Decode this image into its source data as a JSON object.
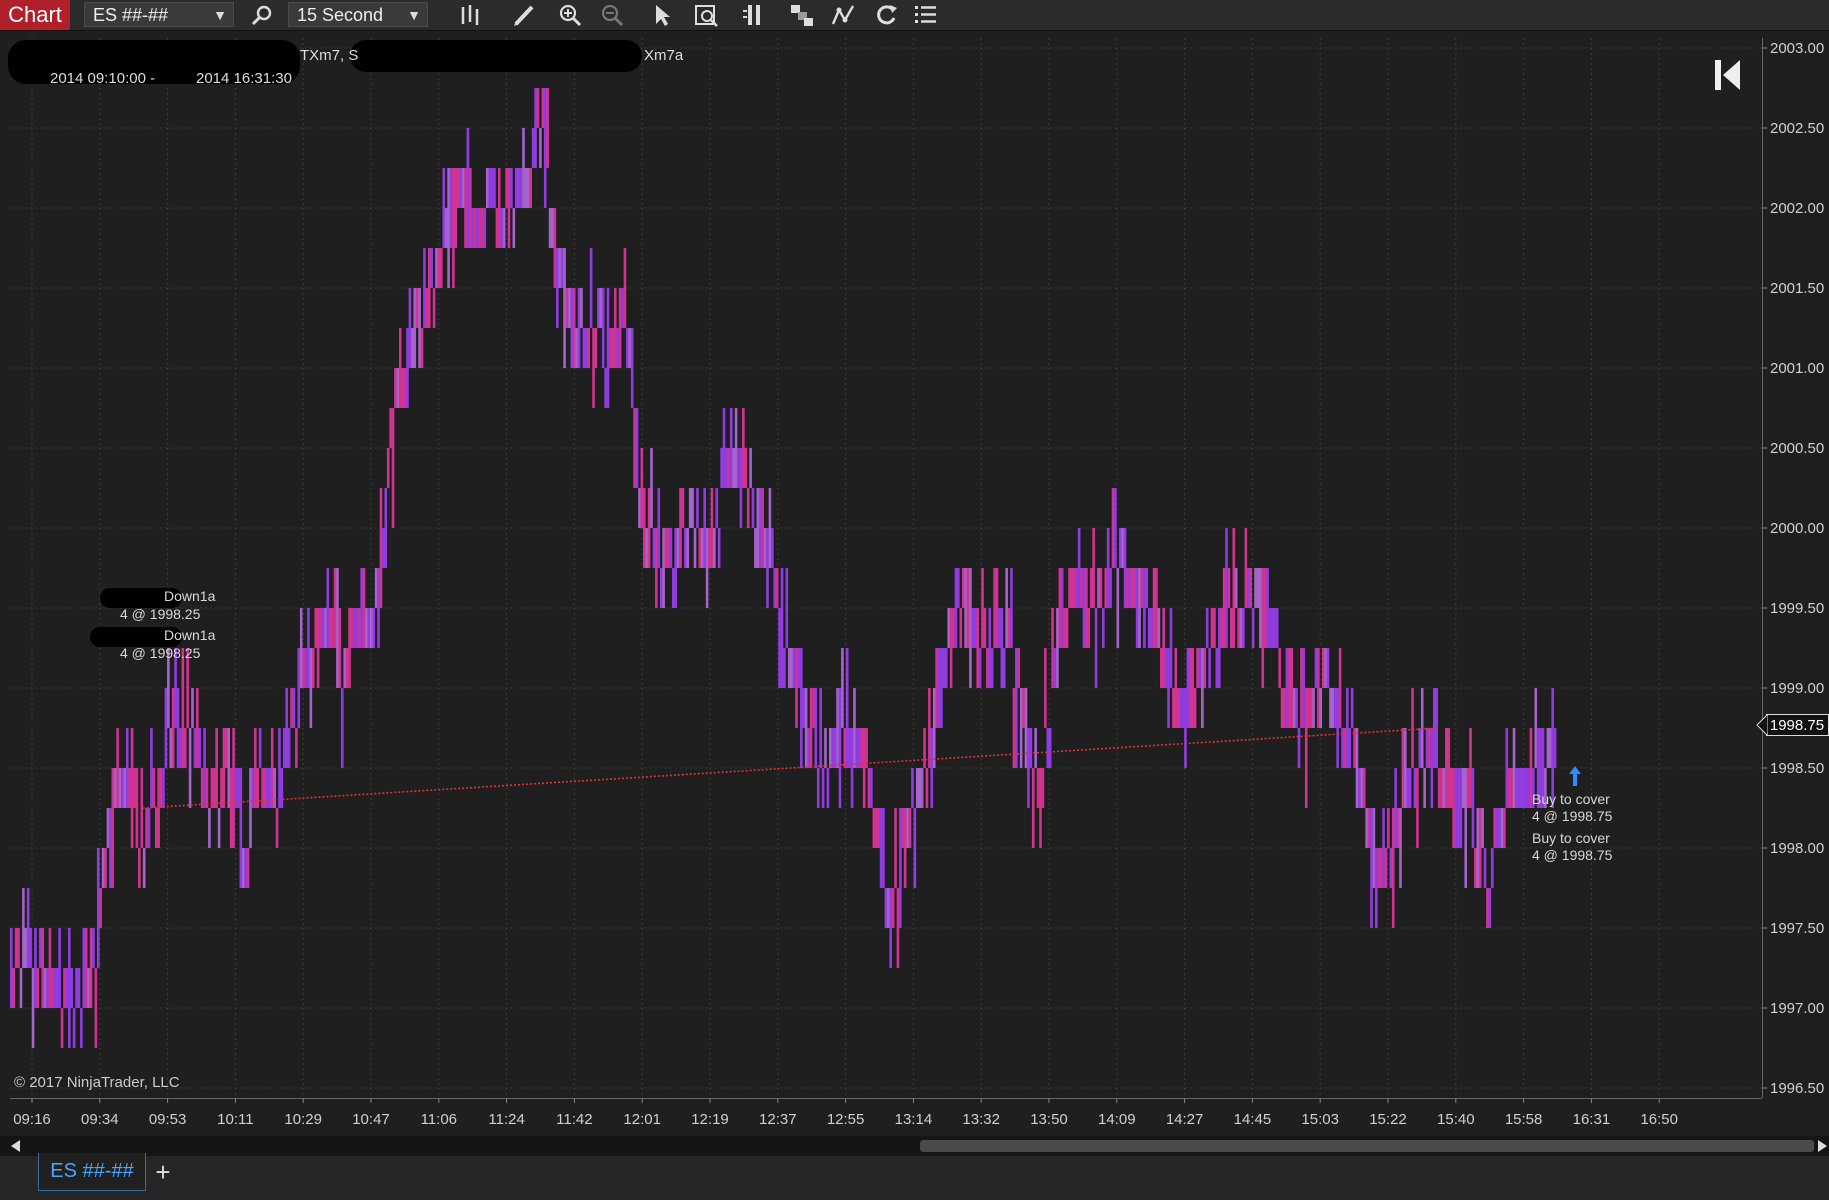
{
  "toolbar": {
    "tab_label": "Chart",
    "instrument": "ES ##-##",
    "interval": "15 Second",
    "icons": [
      "search-icon",
      "bars-type-icon",
      "draw-pencil-icon",
      "zoom-in-icon",
      "zoom-out-icon",
      "pointer-icon",
      "data-box-icon",
      "columns-icon",
      "strategy-icon",
      "indicator-icon",
      "refresh-icon",
      "properties-list-icon"
    ]
  },
  "overlay": {
    "series_text_a": "TXm7, S",
    "series_text_b": "Xm7a",
    "range_start": "2014 09:10:00 -",
    "range_end": "2014 16:31:30",
    "copyright": "© 2017 NinjaTrader, LLC"
  },
  "annotations": {
    "entry1_name": "Down1a",
    "entry1_fill": "4 @ 1998.25",
    "entry2_name": "Down1a",
    "entry2_fill": "4 @ 1998.25",
    "exit1_name": "Buy to cover",
    "exit1_fill": "4 @ 1998.75",
    "exit2_name": "Buy to cover",
    "exit2_fill": "4 @ 1998.75"
  },
  "colors": {
    "background": "#1f1f1f",
    "grid": "#3a3a3a",
    "bar_a": "#e0359a",
    "bar_b": "#9a3ff0",
    "bar_c": "#b06ad8",
    "trade_line": "#e0303a",
    "accent_tab": "#4aa3ff"
  },
  "bottom_tabs": {
    "instrument_tab": "ES ##-##",
    "add": "+"
  },
  "chart_data": {
    "type": "bar",
    "ylim": [
      1996.5,
      2003.0
    ],
    "y_ticks": [
      "2003.00",
      "2002.50",
      "2002.00",
      "2001.50",
      "2001.00",
      "2000.50",
      "2000.00",
      "1999.50",
      "1999.00",
      "1998.50",
      "1998.00",
      "1997.50",
      "1997.00",
      "1996.50"
    ],
    "x_ticks": [
      "09:16",
      "09:34",
      "09:53",
      "10:11",
      "10:29",
      "10:47",
      "11:06",
      "11:24",
      "11:42",
      "12:01",
      "12:19",
      "12:37",
      "12:55",
      "13:14",
      "13:32",
      "13:50",
      "14:09",
      "14:27",
      "14:45",
      "15:03",
      "15:22",
      "15:40",
      "15:58",
      "16:31",
      "16:50"
    ],
    "last_price": "1998.75",
    "price_path": [
      [
        0.0,
        1997.3
      ],
      [
        0.02,
        1997.3
      ],
      [
        0.04,
        1997.1
      ],
      [
        0.05,
        1997.4
      ],
      [
        0.06,
        1998.3
      ],
      [
        0.07,
        1998.5
      ],
      [
        0.08,
        1998.1
      ],
      [
        0.09,
        1998.6
      ],
      [
        0.1,
        1998.9
      ],
      [
        0.11,
        1998.8
      ],
      [
        0.12,
        1998.3
      ],
      [
        0.13,
        1998.6
      ],
      [
        0.14,
        1998.1
      ],
      [
        0.15,
        1998.6
      ],
      [
        0.16,
        1998.4
      ],
      [
        0.17,
        1998.9
      ],
      [
        0.18,
        1999.3
      ],
      [
        0.19,
        1999.6
      ],
      [
        0.2,
        1999.2
      ],
      [
        0.21,
        1999.5
      ],
      [
        0.22,
        1999.7
      ],
      [
        0.23,
        2000.7
      ],
      [
        0.24,
        2001.3
      ],
      [
        0.25,
        2001.5
      ],
      [
        0.26,
        2001.9
      ],
      [
        0.27,
        2002.3
      ],
      [
        0.28,
        2002.0
      ],
      [
        0.29,
        2002.2
      ],
      [
        0.3,
        2002.0
      ],
      [
        0.31,
        2002.3
      ],
      [
        0.32,
        2002.6
      ],
      [
        0.33,
        2001.8
      ],
      [
        0.34,
        2001.3
      ],
      [
        0.35,
        2001.4
      ],
      [
        0.36,
        2001.2
      ],
      [
        0.37,
        2001.6
      ],
      [
        0.38,
        2000.2
      ],
      [
        0.39,
        2000.0
      ],
      [
        0.4,
        1999.9
      ],
      [
        0.41,
        2000.2
      ],
      [
        0.42,
        1999.9
      ],
      [
        0.43,
        2000.4
      ],
      [
        0.44,
        2000.5
      ],
      [
        0.45,
        2000.1
      ],
      [
        0.46,
        1999.7
      ],
      [
        0.47,
        1999.3
      ],
      [
        0.48,
        1998.9
      ],
      [
        0.49,
        1998.6
      ],
      [
        0.5,
        1998.9
      ],
      [
        0.51,
        1998.8
      ],
      [
        0.52,
        1998.4
      ],
      [
        0.53,
        1997.7
      ],
      [
        0.54,
        1998.3
      ],
      [
        0.55,
        1998.6
      ],
      [
        0.56,
        1998.9
      ],
      [
        0.57,
        1999.7
      ],
      [
        0.58,
        1999.5
      ],
      [
        0.59,
        1999.3
      ],
      [
        0.6,
        1999.4
      ],
      [
        0.61,
        1998.9
      ],
      [
        0.62,
        1998.5
      ],
      [
        0.63,
        1999.3
      ],
      [
        0.64,
        1999.8
      ],
      [
        0.65,
        1999.6
      ],
      [
        0.66,
        1999.8
      ],
      [
        0.67,
        1999.9
      ],
      [
        0.68,
        1999.6
      ],
      [
        0.69,
        1999.5
      ],
      [
        0.7,
        1999.1
      ],
      [
        0.71,
        1999.0
      ],
      [
        0.72,
        1999.3
      ],
      [
        0.73,
        1999.6
      ],
      [
        0.74,
        1999.7
      ],
      [
        0.75,
        1999.6
      ],
      [
        0.76,
        1999.5
      ],
      [
        0.77,
        1999.0
      ],
      [
        0.78,
        1998.9
      ],
      [
        0.79,
        1999.2
      ],
      [
        0.8,
        1998.9
      ],
      [
        0.81,
        1998.7
      ],
      [
        0.82,
        1998.1
      ],
      [
        0.83,
        1998.0
      ],
      [
        0.84,
        1998.4
      ],
      [
        0.85,
        1998.7
      ],
      [
        0.86,
        1998.6
      ],
      [
        0.87,
        1998.5
      ],
      [
        0.88,
        1998.2
      ],
      [
        0.89,
        1997.9
      ],
      [
        0.9,
        1998.4
      ],
      [
        0.91,
        1998.5
      ],
      [
        0.92,
        1998.6
      ],
      [
        0.93,
        1998.8
      ]
    ],
    "trade_line": {
      "from": [
        0.08,
        1998.25
      ],
      "to": [
        0.86,
        1998.75
      ]
    }
  }
}
